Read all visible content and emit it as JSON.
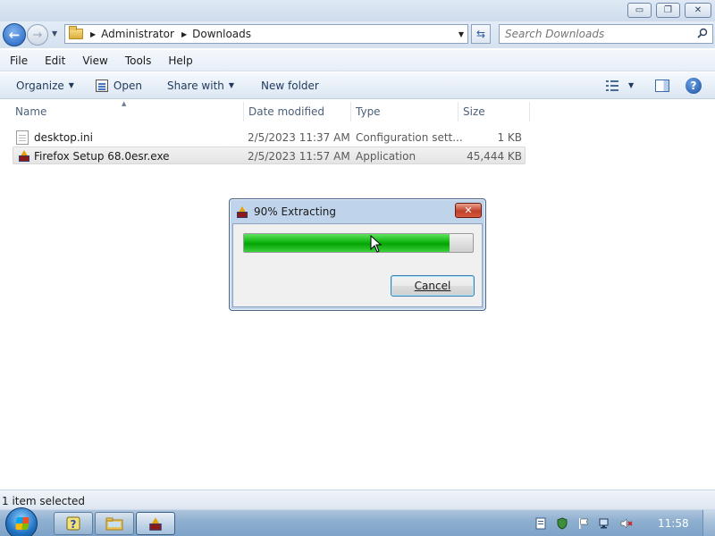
{
  "window": {
    "minimize_glyph": "▭",
    "maximize_glyph": "❐",
    "close_glyph": "✕"
  },
  "address": {
    "crumbs": [
      "Administrator",
      "Downloads"
    ],
    "search_placeholder": "Search Downloads"
  },
  "menu": {
    "items": [
      "File",
      "Edit",
      "View",
      "Tools",
      "Help"
    ]
  },
  "toolbar": {
    "organize_label": "Organize",
    "open_label": "Open",
    "share_label": "Share with",
    "new_folder_label": "New folder"
  },
  "columns": {
    "name": "Name",
    "date": "Date modified",
    "type": "Type",
    "size": "Size"
  },
  "files": [
    {
      "name": "desktop.ini",
      "date": "2/5/2023 11:37 AM",
      "type": "Configuration sett...",
      "size": "1 KB",
      "selected": false
    },
    {
      "name": "Firefox Setup 68.0esr.exe",
      "date": "2/5/2023 11:57 AM",
      "type": "Application",
      "size": "45,444 KB",
      "selected": true
    }
  ],
  "dialog": {
    "title": "90% Extracting",
    "progress": 0.9,
    "cancel_label": "Cancel",
    "close_glyph": "✕"
  },
  "status": {
    "text": "1 item selected"
  },
  "taskbar": {
    "clock": "11:58"
  },
  "colors": {
    "progress_green": "#0fb50f",
    "accent_blue": "#1e395b"
  }
}
